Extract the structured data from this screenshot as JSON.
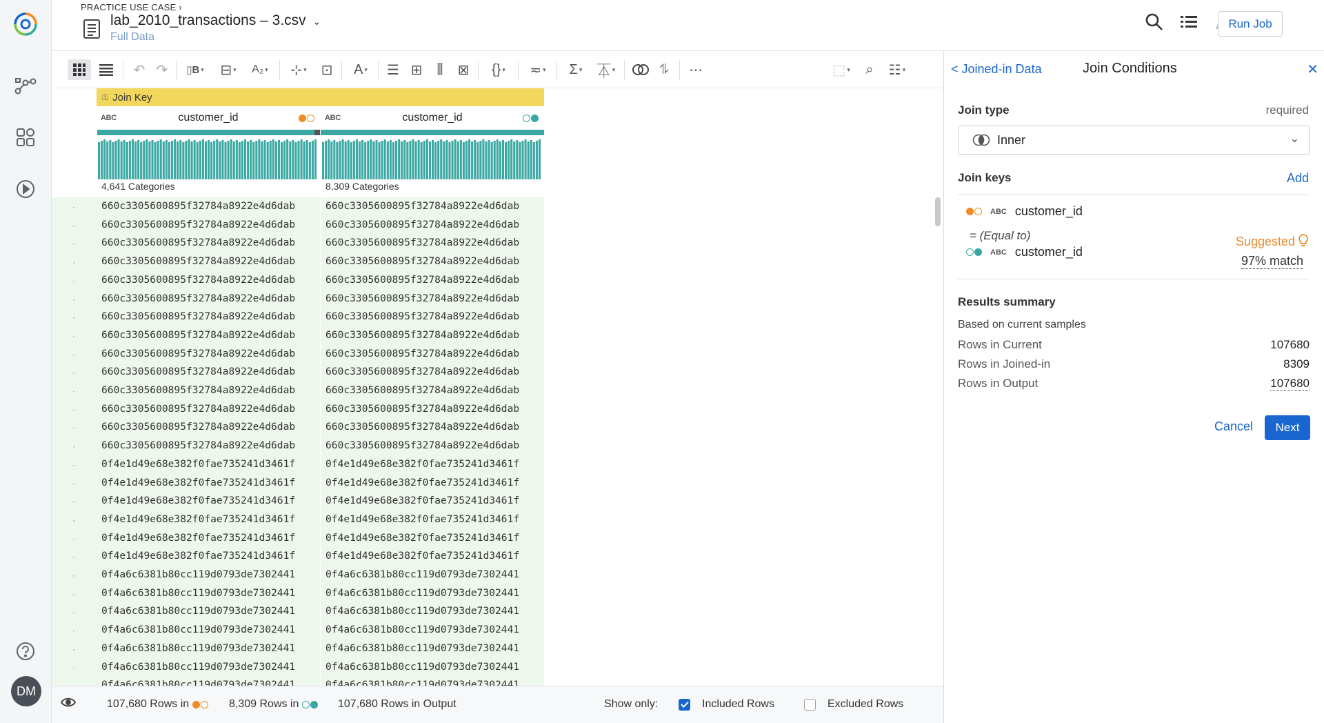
{
  "header": {
    "breadcrumb": "PRACTICE USE CASE",
    "title": "lab_2010_transactions – 3.csv",
    "subtitle": "Full Data",
    "run_job_label": "Run Job"
  },
  "user": {
    "initials": "DM"
  },
  "grid": {
    "join_key_label": "Join Key",
    "columns": [
      {
        "type": "ABC",
        "name": "customer_id",
        "categories": "4,641 Categories"
      },
      {
        "type": "ABC",
        "name": "customer_id",
        "categories": "8,309 Categories"
      }
    ],
    "rows": [
      "660c3305600895f32784a8922e4d6dab",
      "660c3305600895f32784a8922e4d6dab",
      "660c3305600895f32784a8922e4d6dab",
      "660c3305600895f32784a8922e4d6dab",
      "660c3305600895f32784a8922e4d6dab",
      "660c3305600895f32784a8922e4d6dab",
      "660c3305600895f32784a8922e4d6dab",
      "660c3305600895f32784a8922e4d6dab",
      "660c3305600895f32784a8922e4d6dab",
      "660c3305600895f32784a8922e4d6dab",
      "660c3305600895f32784a8922e4d6dab",
      "660c3305600895f32784a8922e4d6dab",
      "660c3305600895f32784a8922e4d6dab",
      "660c3305600895f32784a8922e4d6dab",
      "0f4e1d49e68e382f0fae735241d3461f",
      "0f4e1d49e68e382f0fae735241d3461f",
      "0f4e1d49e68e382f0fae735241d3461f",
      "0f4e1d49e68e382f0fae735241d3461f",
      "0f4e1d49e68e382f0fae735241d3461f",
      "0f4e1d49e68e382f0fae735241d3461f",
      "0f4a6c6381b80cc119d0793de7302441",
      "0f4a6c6381b80cc119d0793de7302441",
      "0f4a6c6381b80cc119d0793de7302441",
      "0f4a6c6381b80cc119d0793de7302441",
      "0f4a6c6381b80cc119d0793de7302441",
      "0f4a6c6381b80cc119d0793de7302441",
      "0f4a6c6381b80cc119d0793de7302441"
    ]
  },
  "footer": {
    "rows_in_current": "107,680 Rows in",
    "rows_in_joined": "8,309 Rows in",
    "rows_in_output": "107,680 Rows in Output",
    "show_only_label": "Show only:",
    "included_label": "Included Rows",
    "excluded_label": "Excluded Rows",
    "included_checked": true,
    "excluded_checked": false
  },
  "panel": {
    "back_label": "< Joined-in Data",
    "title": "Join Conditions",
    "join_type_label": "Join type",
    "required_label": "required",
    "join_type_value": "Inner",
    "join_keys_label": "Join keys",
    "add_label": "Add",
    "key_left": {
      "type": "ABC",
      "name": "customer_id"
    },
    "equal_label": "= (Equal to)",
    "suggested_label": "Suggested",
    "key_right": {
      "type": "ABC",
      "name": "customer_id"
    },
    "match_label": "97% match",
    "results_summary_label": "Results summary",
    "based_on_label": "Based on current samples",
    "summary": [
      {
        "label": "Rows in Current",
        "value": "107680"
      },
      {
        "label": "Rows in Joined-in",
        "value": "8309"
      },
      {
        "label": "Rows in Output",
        "value": "107680"
      }
    ],
    "cancel_label": "Cancel",
    "next_label": "Next"
  },
  "colors": {
    "accent": "#1a66d0",
    "join_key_bar": "#f3d75c",
    "current_dataset": "#f08a24",
    "joined_dataset": "#38a6a2",
    "row_highlight": "#eef7ec"
  }
}
